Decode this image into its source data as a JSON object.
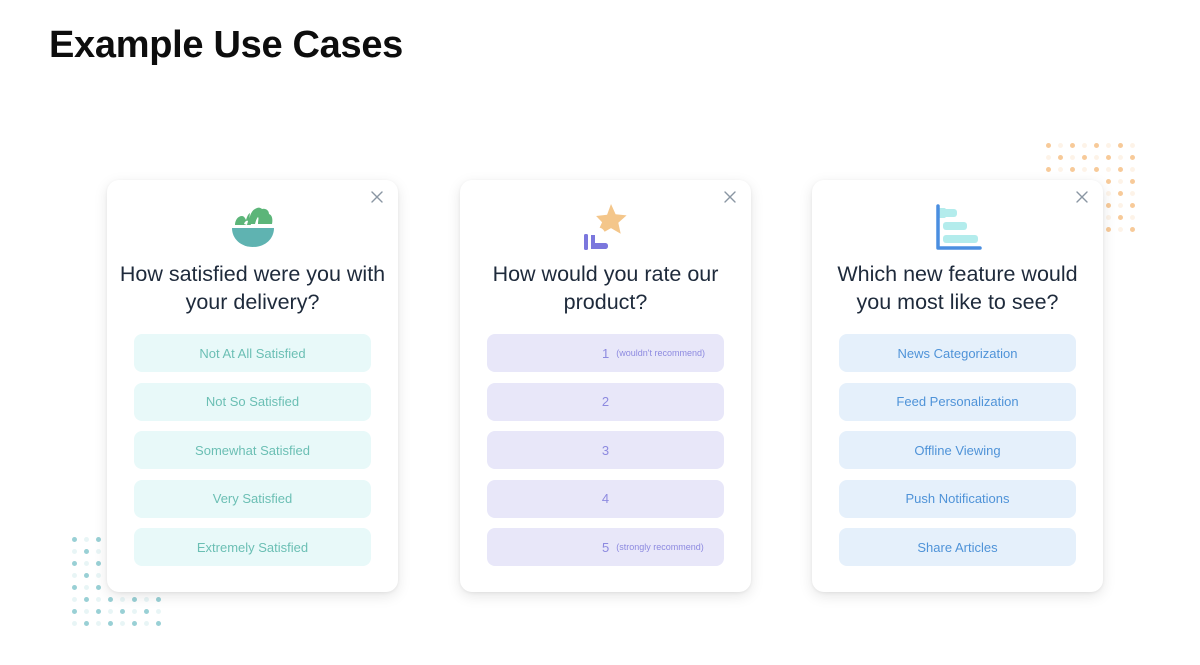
{
  "page": {
    "title": "Example Use Cases"
  },
  "cards": [
    {
      "icon": "salad-bowl-icon",
      "question": "How satisfied were you with your delivery?",
      "close_label": "×",
      "options": [
        {
          "label": "Not At All Satisfied"
        },
        {
          "label": "Not So Satisfied"
        },
        {
          "label": "Somewhat Satisfied"
        },
        {
          "label": "Very Satisfied"
        },
        {
          "label": "Extremely Satisfied"
        }
      ]
    },
    {
      "icon": "hand-star-icon",
      "question": "How would you rate our product?",
      "close_label": "×",
      "options": [
        {
          "label": "1",
          "hint": "(wouldn't recommend)"
        },
        {
          "label": "2"
        },
        {
          "label": "3"
        },
        {
          "label": "4"
        },
        {
          "label": "5",
          "hint": "(strongly recommend)"
        }
      ]
    },
    {
      "icon": "bar-chart-icon",
      "question": "Which new feature would you most like to see?",
      "close_label": "×",
      "options": [
        {
          "label": "News Categorization"
        },
        {
          "label": "Feed Personalization"
        },
        {
          "label": "Offline Viewing"
        },
        {
          "label": "Push Notifications"
        },
        {
          "label": "Share Articles"
        }
      ]
    }
  ],
  "colors": {
    "teal_accent": "#6bbfb4",
    "purple_accent": "#8d8ae0",
    "blue_accent": "#4f93d8",
    "orange_dots": "#f6c48e",
    "teal_dots": "#8ecbd0"
  }
}
